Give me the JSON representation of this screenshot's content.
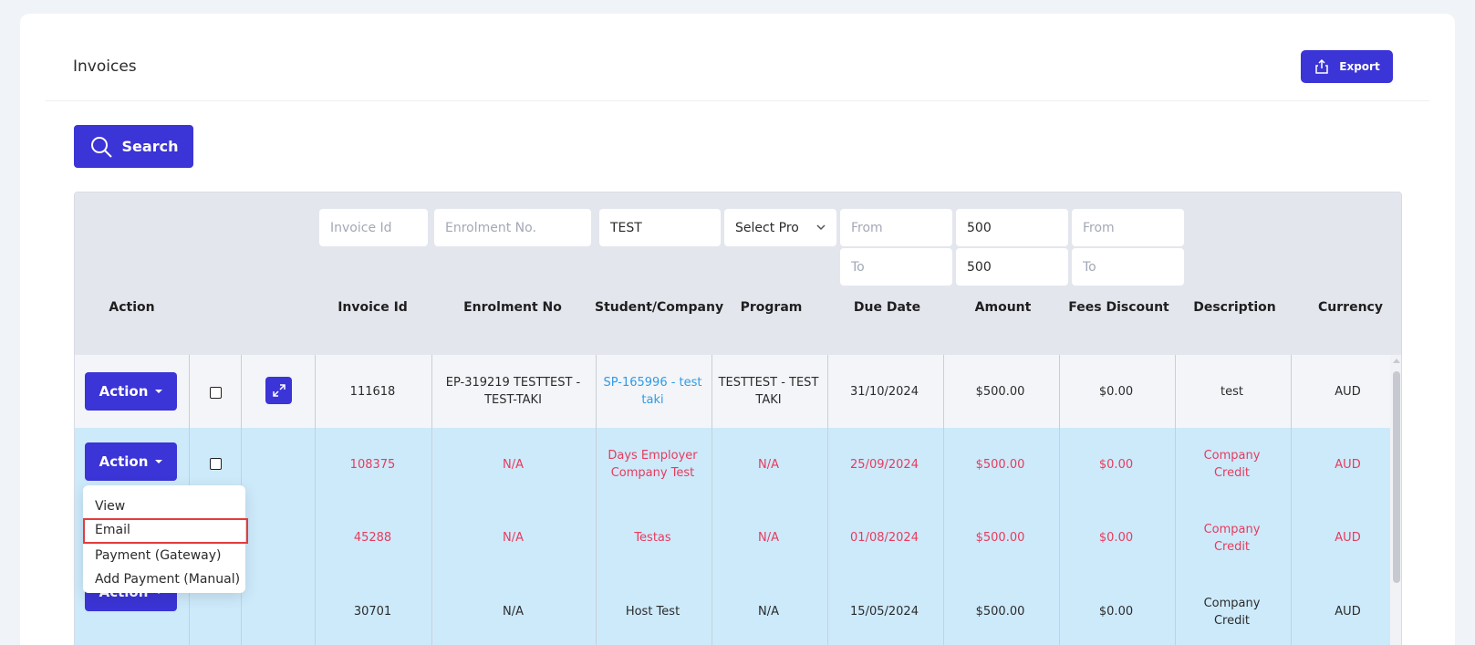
{
  "page": {
    "title": "Invoices",
    "export_label": "Export",
    "search_label": "Search"
  },
  "filters": {
    "invoice_id_placeholder": "Invoice Id",
    "enrolment_placeholder": "Enrolment No.",
    "student_value": "TEST",
    "program_placeholder": "Select Pro",
    "due_from_placeholder": "From",
    "due_to_placeholder": "To",
    "amount_from_value": "500",
    "amount_to_value": "500",
    "discount_from_placeholder": "From",
    "discount_to_placeholder": "To"
  },
  "columns": {
    "action": "Action",
    "invoice_id": "Invoice Id",
    "enrolment_no": "Enrolment No",
    "student_company": "Student/Company",
    "program": "Program",
    "due_date": "Due Date",
    "amount": "Amount",
    "fees_discount": "Fees Discount",
    "description": "Description",
    "currency": "Currency"
  },
  "action_label": "Action",
  "rows": [
    {
      "invoice_id": "111618",
      "enrolment_no": "EP-319219 TESTTEST - TEST-TAKI",
      "student": "SP-165996 - test taki",
      "program": "TESTTEST - TEST TAKI",
      "due_date": "31/10/2024",
      "amount": "$500.00",
      "discount": "$0.00",
      "description": "test",
      "currency": "AUD",
      "status_color": "#2b2b2b"
    },
    {
      "invoice_id": "108375",
      "enrolment_no": "N/A",
      "student": "Days Employer Company Test",
      "program": "N/A",
      "due_date": "25/09/2024",
      "amount": "$500.00",
      "discount": "$0.00",
      "description": "Company Credit",
      "currency": "AUD",
      "status_color": "#e83b5c"
    },
    {
      "invoice_id": "45288",
      "enrolment_no": "N/A",
      "student": "Testas",
      "program": "N/A",
      "due_date": "01/08/2024",
      "amount": "$500.00",
      "discount": "$0.00",
      "description": "Company Credit",
      "currency": "AUD",
      "status_color": "#e83b5c"
    },
    {
      "invoice_id": "30701",
      "enrolment_no": "N/A",
      "student": "Host Test",
      "program": "N/A",
      "due_date": "15/05/2024",
      "amount": "$500.00",
      "discount": "$0.00",
      "description": "Company Credit",
      "currency": "AUD",
      "status_color": "#2b2b2b"
    }
  ],
  "dropdown": {
    "items": [
      "View",
      "Email",
      "Payment (Gateway)",
      "Add Payment (Manual)"
    ],
    "highlighted": "Email"
  },
  "colors": {
    "primary": "#3b34d6",
    "overdue_text": "#e83b5c",
    "link_text": "#2f9be8",
    "selected_row": "#cdeafb"
  }
}
